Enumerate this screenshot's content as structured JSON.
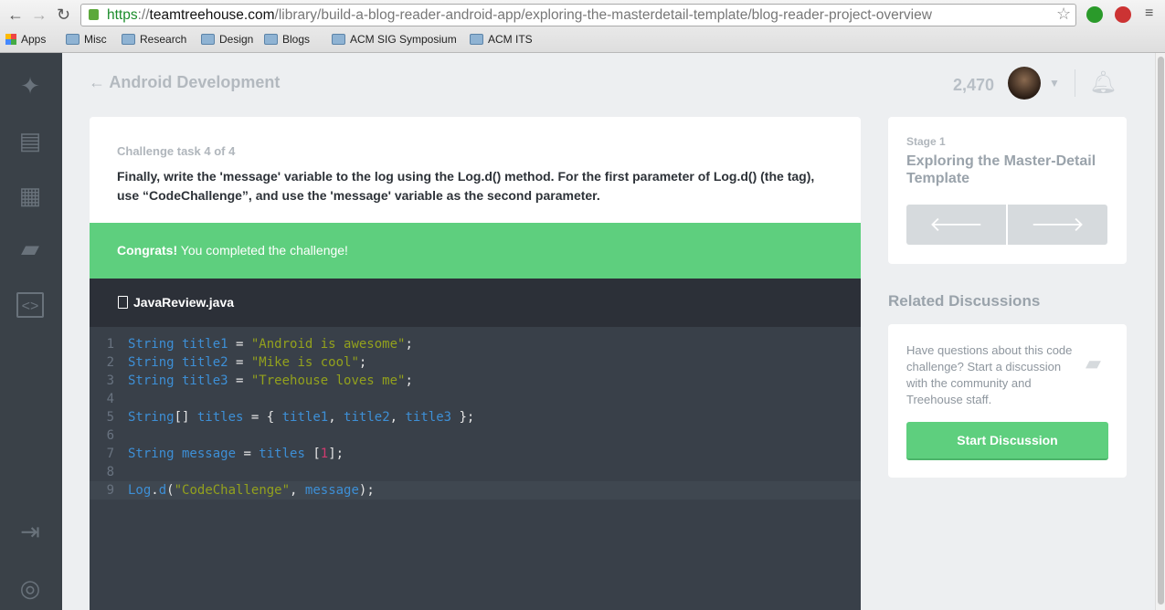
{
  "browser": {
    "url_scheme": "https",
    "url_host": "teamtreehouse.com",
    "url_path": "/library/build-a-blog-reader-android-app/exploring-the-masterdetail-template/blog-reader-project-overview",
    "bookmarks": [
      "Apps",
      "Misc",
      "Research",
      "Design",
      "Blogs",
      "ACM SIG Symposium",
      "ACM ITS"
    ]
  },
  "sidebar": {
    "icons": [
      "treehouse-logo-icon",
      "library-map-icon",
      "tracks-icon",
      "forum-icon",
      "workspaces-icon",
      "sign-out-icon",
      "help-icon"
    ]
  },
  "header": {
    "back_label": "Android Development",
    "points": "2,470"
  },
  "challenge": {
    "task": "Challenge task 4 of 4",
    "description": "Finally, write the 'message' variable to the log using the Log.d() method. For the first parameter of Log.d() (the tag), use “CodeChallenge”, and use the 'message' variable as the second parameter.",
    "congrats_bold": "Congrats!",
    "congrats_text": " You completed the challenge!",
    "filename": "JavaReview.java"
  },
  "code": [
    [
      [
        "k",
        "String title1 "
      ],
      [
        "p",
        "= "
      ],
      [
        "s",
        "\"Android is awesome\""
      ],
      [
        "p",
        ";"
      ]
    ],
    [
      [
        "k",
        "String title2 "
      ],
      [
        "p",
        "= "
      ],
      [
        "s",
        "\"Mike is cool\""
      ],
      [
        "p",
        ";"
      ]
    ],
    [
      [
        "k",
        "String title3 "
      ],
      [
        "p",
        "= "
      ],
      [
        "s",
        "\"Treehouse loves me\""
      ],
      [
        "p",
        ";"
      ]
    ],
    [],
    [
      [
        "k",
        "String"
      ],
      [
        "p",
        "[] "
      ],
      [
        "k",
        "titles "
      ],
      [
        "p",
        "= { "
      ],
      [
        "k",
        "title1"
      ],
      [
        "p",
        ", "
      ],
      [
        "k",
        "title2"
      ],
      [
        "p",
        ", "
      ],
      [
        "k",
        "title3 "
      ],
      [
        "p",
        "};"
      ]
    ],
    [],
    [
      [
        "k",
        "String message "
      ],
      [
        "p",
        "= "
      ],
      [
        "k",
        "titles "
      ],
      [
        "p",
        "["
      ],
      [
        "n",
        "1"
      ],
      [
        "p",
        "];"
      ]
    ],
    [],
    [
      [
        "k",
        "Log"
      ],
      [
        "p",
        "."
      ],
      [
        "k",
        "d"
      ],
      [
        "p",
        "("
      ],
      [
        "s",
        "\"CodeChallenge\""
      ],
      [
        "p",
        ", "
      ],
      [
        "k",
        "message"
      ],
      [
        "p",
        ");"
      ]
    ]
  ],
  "stage": {
    "label": "Stage 1",
    "title": "Exploring the Master-Detail Template",
    "prev": "🡐",
    "next": "🡒"
  },
  "related": {
    "heading": "Related Discussions",
    "text": "Have questions about this code challenge? Start a discussion with the community and Treehouse staff.",
    "button": "Start Discussion"
  },
  "colors": {
    "success": "#5ecf7e",
    "sidebar": "#3a4148",
    "code_bg": "#394049"
  }
}
